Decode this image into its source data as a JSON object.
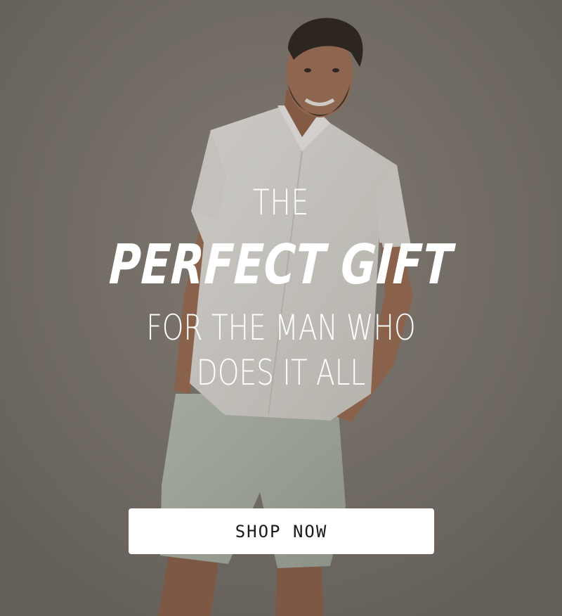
{
  "hero": {
    "line_1": "THE",
    "line_2": "PERFECT GIFT",
    "line_3": "FOR THE MAN WHO",
    "line_4": "DOES IT ALL",
    "cta_label": "SHOP NOW"
  },
  "colors": {
    "background": "#7f7972",
    "shirt": "#e6e4e0",
    "shorts": "#b3bbb1",
    "skin": "#a06f55",
    "text": "#ffffff",
    "button_bg": "#ffffff",
    "button_text": "#1a1a1a"
  }
}
